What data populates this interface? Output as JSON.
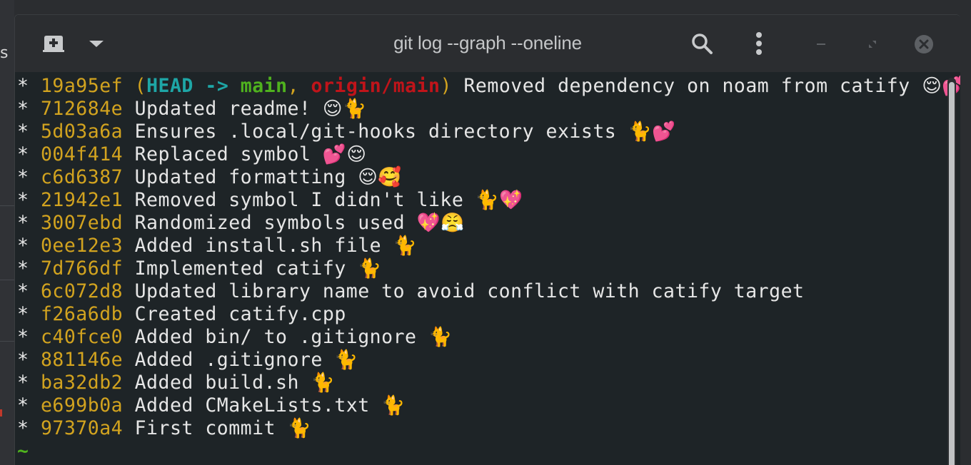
{
  "background_app": {
    "partial_text": "s"
  },
  "window": {
    "title": "git log --graph --oneline",
    "icons": {
      "new_tab": "new-tab-icon",
      "tab_menu": "chevron-down-icon",
      "search": "search-icon",
      "menu": "kebab-menu-icon",
      "minimize": "minimize-icon",
      "maximize": "maximize-icon",
      "close": "close-icon"
    }
  },
  "colors": {
    "hash": "#d2a31f",
    "head_ref": "#1ea6a6",
    "branch_local": "#4fb21e",
    "branch_remote": "#c0141a",
    "text": "#e6e6e6",
    "terminal_bg": "#1e2427"
  },
  "graph_marker": "*",
  "head_decoration": {
    "open": "(",
    "head": "HEAD",
    "arrow": "->",
    "branch": "main",
    "comma": ",",
    "remote": "origin/main",
    "close": ")"
  },
  "commits": [
    {
      "hash": "19a95ef",
      "message": "Removed dependency on noam from catify",
      "emoji": "😌💕"
    },
    {
      "hash": "712684e",
      "message": "Updated readme!",
      "emoji": "😌🐈"
    },
    {
      "hash": "5d03a6a",
      "message": "Ensures .local/git-hooks directory exists",
      "emoji": "🐈💕"
    },
    {
      "hash": "004f414",
      "message": "Replaced symbol",
      "emoji": "💕😌"
    },
    {
      "hash": "c6d6387",
      "message": "Updated formatting",
      "emoji": "😌🥰"
    },
    {
      "hash": "21942e1",
      "message": "Removed symbol I didn't like",
      "emoji": "🐈💖"
    },
    {
      "hash": "3007ebd",
      "message": "Randomized symbols used",
      "emoji": "💖😤"
    },
    {
      "hash": "0ee12e3",
      "message": "Added install.sh file",
      "emoji": "🐈"
    },
    {
      "hash": "7d766df",
      "message": "Implemented catify",
      "emoji": "🐈"
    },
    {
      "hash": "6c072d8",
      "message": "Updated library name to avoid conflict with catify target",
      "emoji": ""
    },
    {
      "hash": "f26a6db",
      "message": "Created catify.cpp",
      "emoji": ""
    },
    {
      "hash": "c40fce0",
      "message": "Added bin/ to .gitignore",
      "emoji": "🐈"
    },
    {
      "hash": "881146e",
      "message": "Added .gitignore",
      "emoji": "🐈"
    },
    {
      "hash": "ba32db2",
      "message": "Added build.sh",
      "emoji": "🐈"
    },
    {
      "hash": "e699b0a",
      "message": "Added CMakeLists.txt",
      "emoji": "🐈"
    },
    {
      "hash": "97370a4",
      "message": "First commit",
      "emoji": "🐈"
    }
  ],
  "prompt_tilde": "~"
}
